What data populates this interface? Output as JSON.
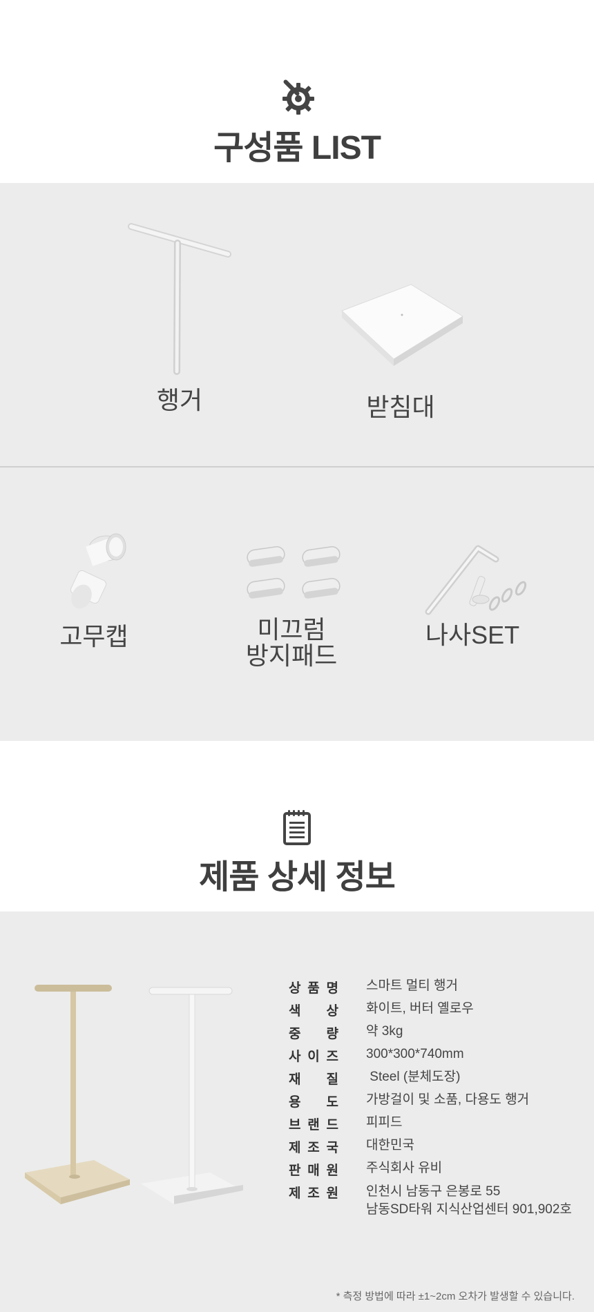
{
  "components_section": {
    "icon": "gear-wrench-icon",
    "title": "구성품 LIST",
    "items_row1": [
      {
        "label": "행거",
        "icon": "t-hanger-image"
      },
      {
        "label": "받침대",
        "icon": "base-plate-image"
      }
    ],
    "items_row2": [
      {
        "label": "고무캡",
        "icon": "rubber-cap-image"
      },
      {
        "label_line1": "미끄럼",
        "label_line2": "방지패드",
        "icon": "anti-slip-pad-image"
      },
      {
        "label": "나사SET",
        "icon": "screw-set-image"
      }
    ]
  },
  "details_section": {
    "icon": "notepad-icon",
    "title": "제품 상세 정보",
    "specs": [
      {
        "key": [
          "상",
          "품",
          "명"
        ],
        "value": "스마트 멀티 행거"
      },
      {
        "key": [
          "색",
          "상"
        ],
        "value": "화이트, 버터 옐로우"
      },
      {
        "key": [
          "중",
          "량"
        ],
        "value": "약 3kg"
      },
      {
        "key": [
          "사",
          "이",
          "즈"
        ],
        "value": "300*300*740mm"
      },
      {
        "key": [
          "재",
          "질"
        ],
        "value": " Steel (분체도장)"
      },
      {
        "key": [
          "용",
          "도"
        ],
        "value": "가방걸이 및 소품, 다용도 행거"
      },
      {
        "key": [
          "브",
          "랜",
          "드"
        ],
        "value": "피피드"
      },
      {
        "key": [
          "제",
          "조",
          "국"
        ],
        "value": "대한민국"
      },
      {
        "key": [
          "판",
          "매",
          "원"
        ],
        "value": "주식회사 유비"
      },
      {
        "key": [
          "제",
          "조",
          "원"
        ],
        "value": "인천시 남동구 은봉로 55",
        "value2": "남동SD타워 지식산업센터 901,902호"
      }
    ],
    "footnote": "* 측정 방법에 따라 ±1~2cm 오차가 발생할 수 있습니다."
  },
  "colors": {
    "band": "#ececec",
    "title": "#3f3f3f",
    "butter_yellow": "#d6c7a5",
    "white_product": "#f7f7f7"
  }
}
